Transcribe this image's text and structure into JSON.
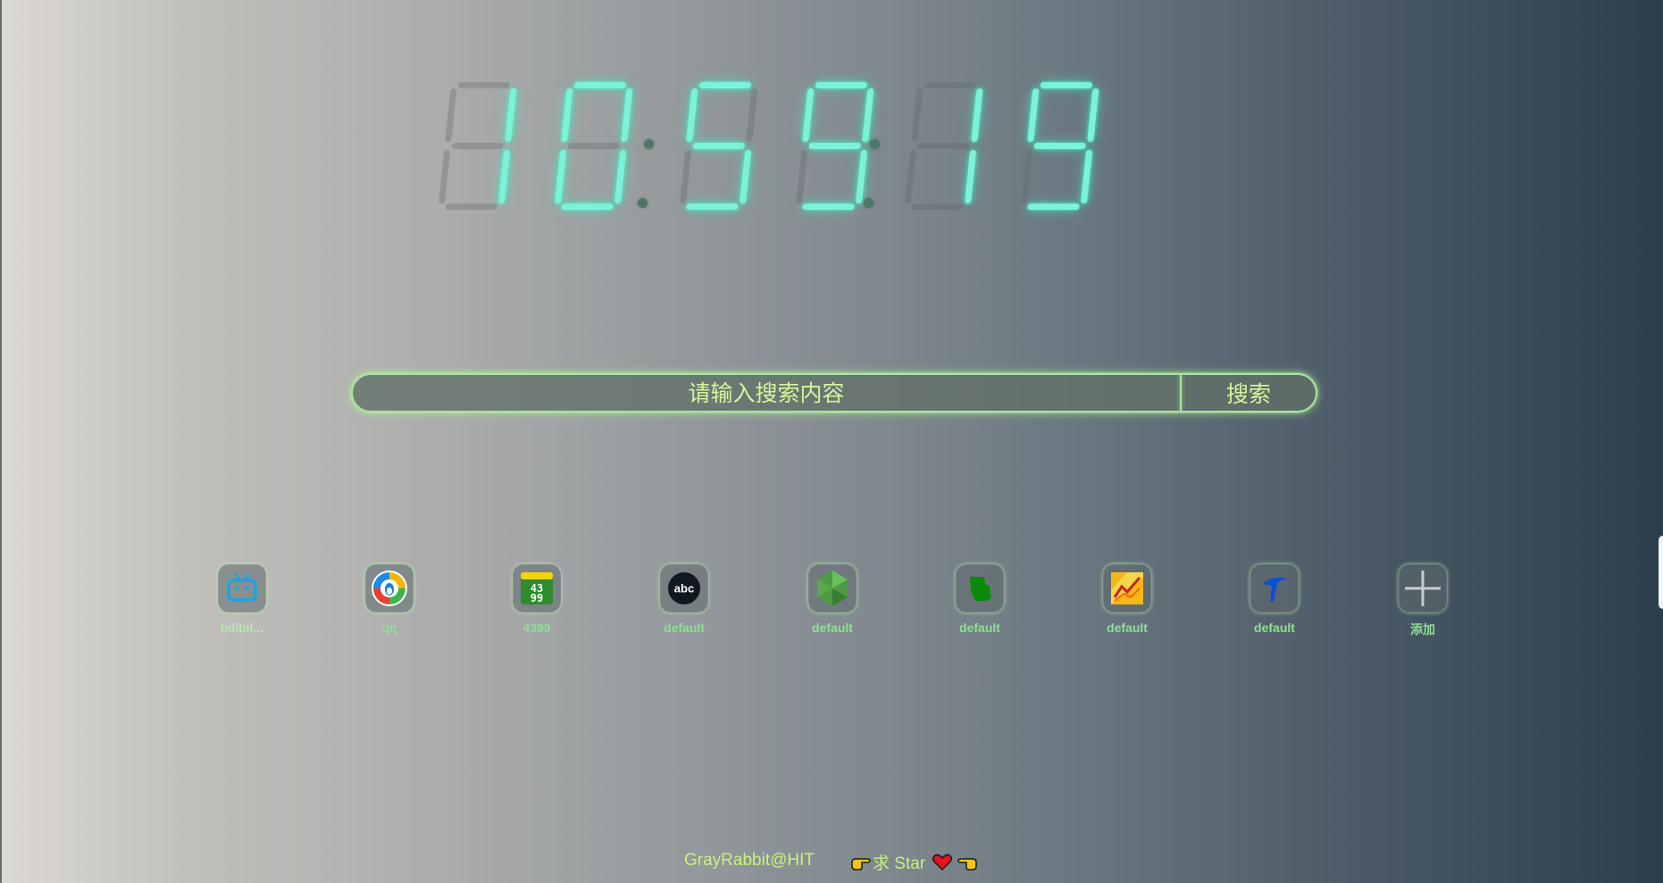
{
  "clock": {
    "time": "10:59:19",
    "digits": [
      "1",
      "0",
      "5",
      "9",
      "1",
      "9"
    ]
  },
  "search": {
    "placeholder": "请输入搜索内容",
    "button_label": "搜索"
  },
  "shortcuts": [
    {
      "label": "bilibil...",
      "icon": "bilibili-tv-icon"
    },
    {
      "label": "qq",
      "icon": "qq-penguin-icon"
    },
    {
      "label": "4399",
      "icon": "4399-logo-icon"
    },
    {
      "label": "default",
      "icon": "abc-logo-icon"
    },
    {
      "label": "default",
      "icon": "green-gem-icon"
    },
    {
      "label": "default",
      "icon": "green-map-icon"
    },
    {
      "label": "default",
      "icon": "colorful-chart-icon"
    },
    {
      "label": "default",
      "icon": "blue-bird-icon"
    },
    {
      "label": "添加",
      "icon": "plus-icon"
    }
  ],
  "footer": {
    "credit": "GrayRabbit@HIT",
    "star_text": "求 Star"
  },
  "colors": {
    "clock_on": "#7cf2d8",
    "search_border": "#a8e6a0",
    "search_text": "#d4f59a",
    "shortcut_label": "#8fdf95",
    "footer_text": "#c9f27d"
  }
}
